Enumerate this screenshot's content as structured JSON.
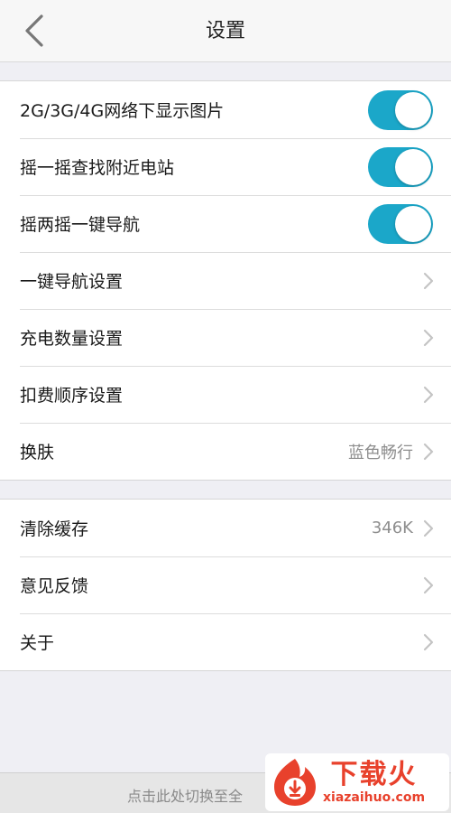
{
  "navbar": {
    "title": "设置",
    "back_icon": "chevron-left-icon"
  },
  "group1": {
    "items": [
      {
        "label": "2G/3G/4G网络下显示图片",
        "type": "toggle",
        "on": true
      },
      {
        "label": "摇一摇查找附近电站",
        "type": "toggle",
        "on": true
      },
      {
        "label": "摇两摇一键导航",
        "type": "toggle",
        "on": true
      },
      {
        "label": "一键导航设置",
        "type": "link"
      },
      {
        "label": "充电数量设置",
        "type": "link"
      },
      {
        "label": "扣费顺序设置",
        "type": "link"
      },
      {
        "label": "换肤",
        "type": "link",
        "value": "蓝色畅行"
      }
    ]
  },
  "group2": {
    "items": [
      {
        "label": "清除缓存",
        "type": "link",
        "value": "346K"
      },
      {
        "label": "意见反馈",
        "type": "link"
      },
      {
        "label": "关于",
        "type": "link"
      }
    ]
  },
  "bottom_bar": {
    "text": "点击此处切换至全"
  },
  "watermark": {
    "name": "下载火",
    "url": "xiazaihuo.com"
  },
  "colors": {
    "toggle_on": "#1ba7c9",
    "background": "#efeff4",
    "watermark": "#e8412c"
  }
}
